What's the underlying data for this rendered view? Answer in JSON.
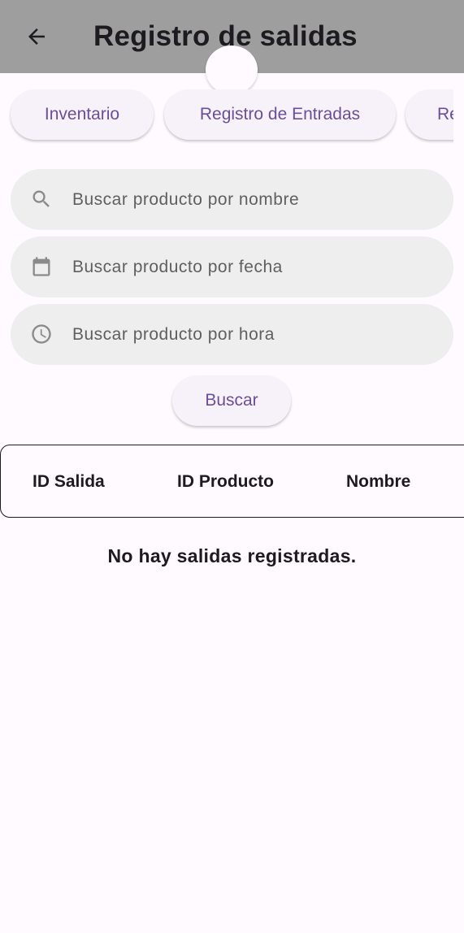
{
  "appbar": {
    "title": "Registro de salidas",
    "back_icon": "arrow-back-icon",
    "background_color": "#9e9e9e"
  },
  "chips": [
    {
      "label": "Inventario"
    },
    {
      "label": "Registro de Entradas"
    },
    {
      "label": "Re"
    }
  ],
  "search": {
    "name_placeholder": "Buscar producto por nombre",
    "date_placeholder": "Buscar producto por fecha",
    "time_placeholder": "Buscar producto por hora",
    "name_icon": "search-icon",
    "date_icon": "calendar-icon",
    "time_icon": "clock-icon",
    "button_label": "Buscar"
  },
  "table": {
    "columns": [
      "ID Salida",
      "ID Producto",
      "Nombre"
    ],
    "rows": []
  },
  "empty_message": "No hay salidas registradas.",
  "colors": {
    "accent": "#6a4e9c",
    "background": "#fefaff",
    "field_background": "#eeeeee"
  }
}
